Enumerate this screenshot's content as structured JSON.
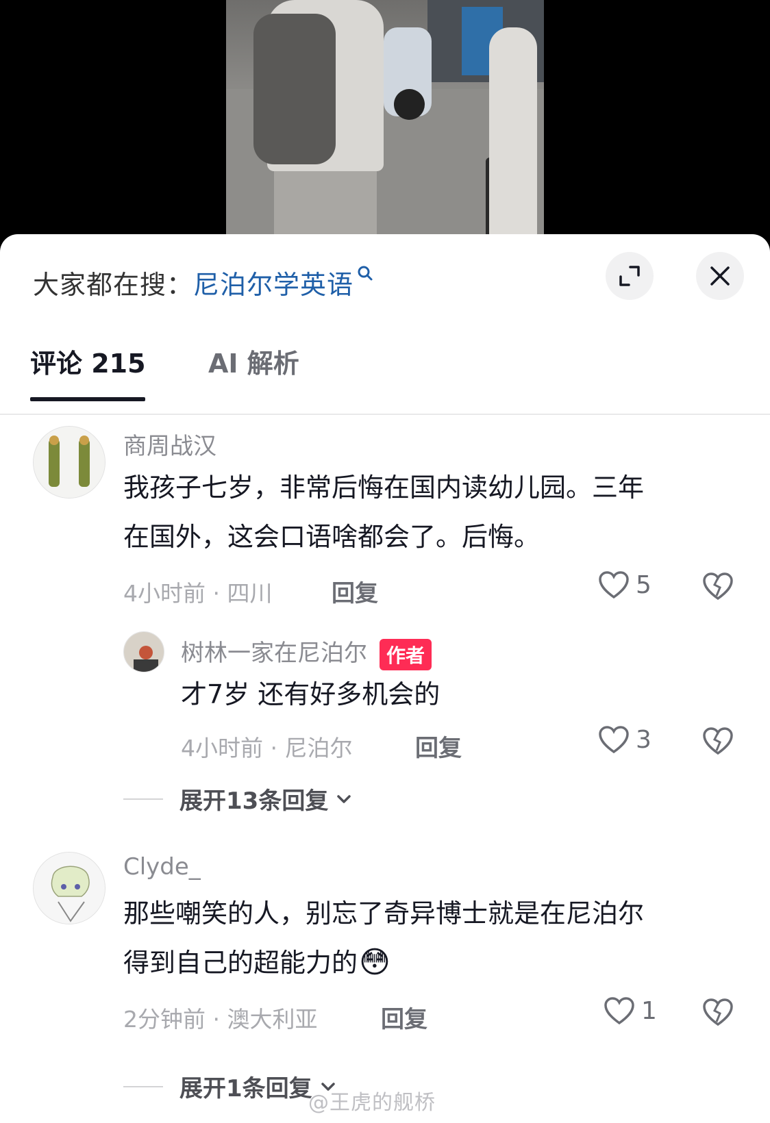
{
  "search_bar": {
    "prefix": "大家都在搜：",
    "term": "尼泊尔学英语"
  },
  "tabs": [
    {
      "label": "评论 215"
    },
    {
      "label": "AI 解析"
    }
  ],
  "comments": [
    {
      "username": "商周战汉",
      "text_lines": [
        "我孩子七岁，非常后悔在国内读幼儿园。三年",
        "在国外，这会口语啥都会了。后悔。"
      ],
      "meta": "4小时前 · 四川",
      "reply_label": "回复",
      "likes": "5",
      "replies": [
        {
          "username": "树林一家在尼泊尔",
          "badge": "作者",
          "text": "才7岁 还有好多机会的",
          "meta": "4小时前 · 尼泊尔",
          "reply_label": "回复",
          "likes": "3"
        }
      ],
      "expand_label": "展开13条回复"
    },
    {
      "username": "Clyde_",
      "text_lines": [
        "那些嘲笑的人，别忘了奇异博士就是在尼泊尔",
        "得到自己的超能力的"
      ],
      "emoji": "😳",
      "meta": "2分钟前 · 澳大利亚",
      "reply_label": "回复",
      "likes": "1",
      "expand_label": "展开1条回复"
    }
  ],
  "watermark": "@王虎的舰桥",
  "colors": {
    "accent_link": "#1f5fa8",
    "author_badge": "#fe2c55",
    "primary_text": "#161823",
    "secondary_text": "#a8a9ae"
  }
}
